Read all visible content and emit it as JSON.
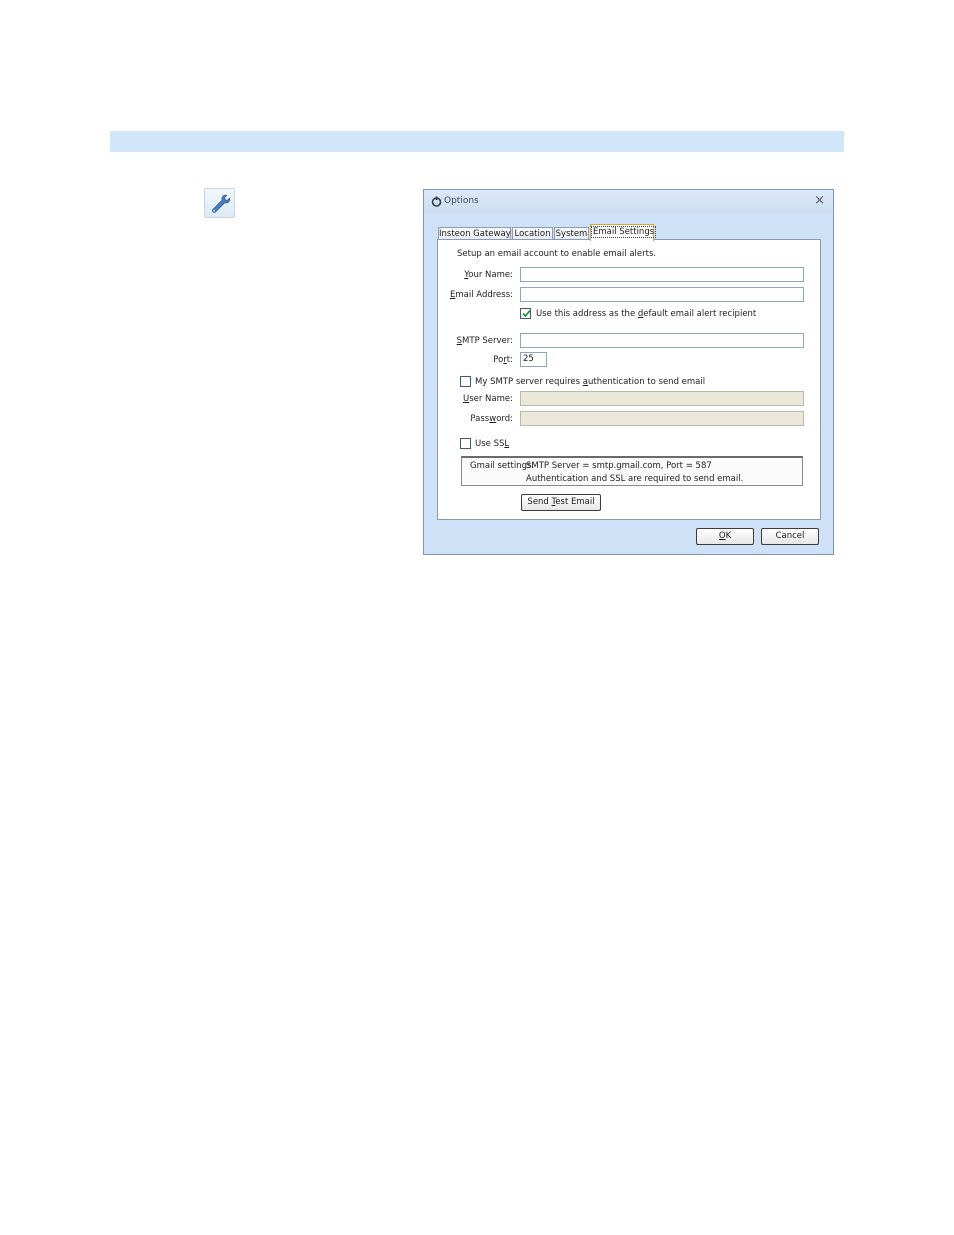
{
  "dialog": {
    "title": "Options",
    "close_glyph": "×",
    "tabs": [
      {
        "label": "Insteon Gateway"
      },
      {
        "label": "Location"
      },
      {
        "label": "System"
      },
      {
        "label": "Email Settings",
        "active": true
      }
    ],
    "intro": "Setup an email account to enable email alerts.",
    "fields": {
      "your_name": {
        "label_pre": "",
        "label_key": "Y",
        "label_post": "our Name:",
        "value": ""
      },
      "email_address": {
        "label_pre": "",
        "label_key": "E",
        "label_post": "mail Address:",
        "value": ""
      },
      "default_recipient": {
        "pre": "Use this address as the ",
        "key": "d",
        "post": "efault email alert recipient",
        "checked": true
      },
      "smtp_server": {
        "label_pre": "",
        "label_key": "S",
        "label_post": "MTP Server:",
        "value": ""
      },
      "port": {
        "label_pre": "Po",
        "label_key": "r",
        "label_post": "t:",
        "value": "25"
      },
      "requires_auth": {
        "pre": "My SMTP server requires ",
        "key": "a",
        "post": "uthentication to send email",
        "checked": false
      },
      "user_name": {
        "label_pre": "",
        "label_key": "U",
        "label_post": "ser Name:",
        "value": "",
        "disabled": true
      },
      "password": {
        "label_pre": "Pass",
        "label_key": "w",
        "label_post": "ord:",
        "value": "",
        "disabled": true
      },
      "use_ssl": {
        "pre": "Use SS",
        "key": "L",
        "post": "",
        "checked": false
      }
    },
    "gmail_info": {
      "label": "Gmail settings:",
      "line1": "SMTP Server = smtp.gmail.com, Port = 587",
      "line2": "Authentication and SSL are required to send email."
    },
    "send_test": {
      "pre": "Send ",
      "key": "T",
      "post": "est Email"
    },
    "ok": {
      "pre": "",
      "key": "O",
      "post": "K"
    },
    "cancel": {
      "label": "Cancel"
    }
  },
  "colors": {
    "banner": "#cfe6fb",
    "dialog_frame": "#cfe1f6",
    "active_tab_border": "#e0a23a",
    "disabled_field": "#ebe8da"
  },
  "icons": {
    "toolbar": "wrench-icon",
    "title": "options-app-icon",
    "check": "checkmark-icon"
  }
}
